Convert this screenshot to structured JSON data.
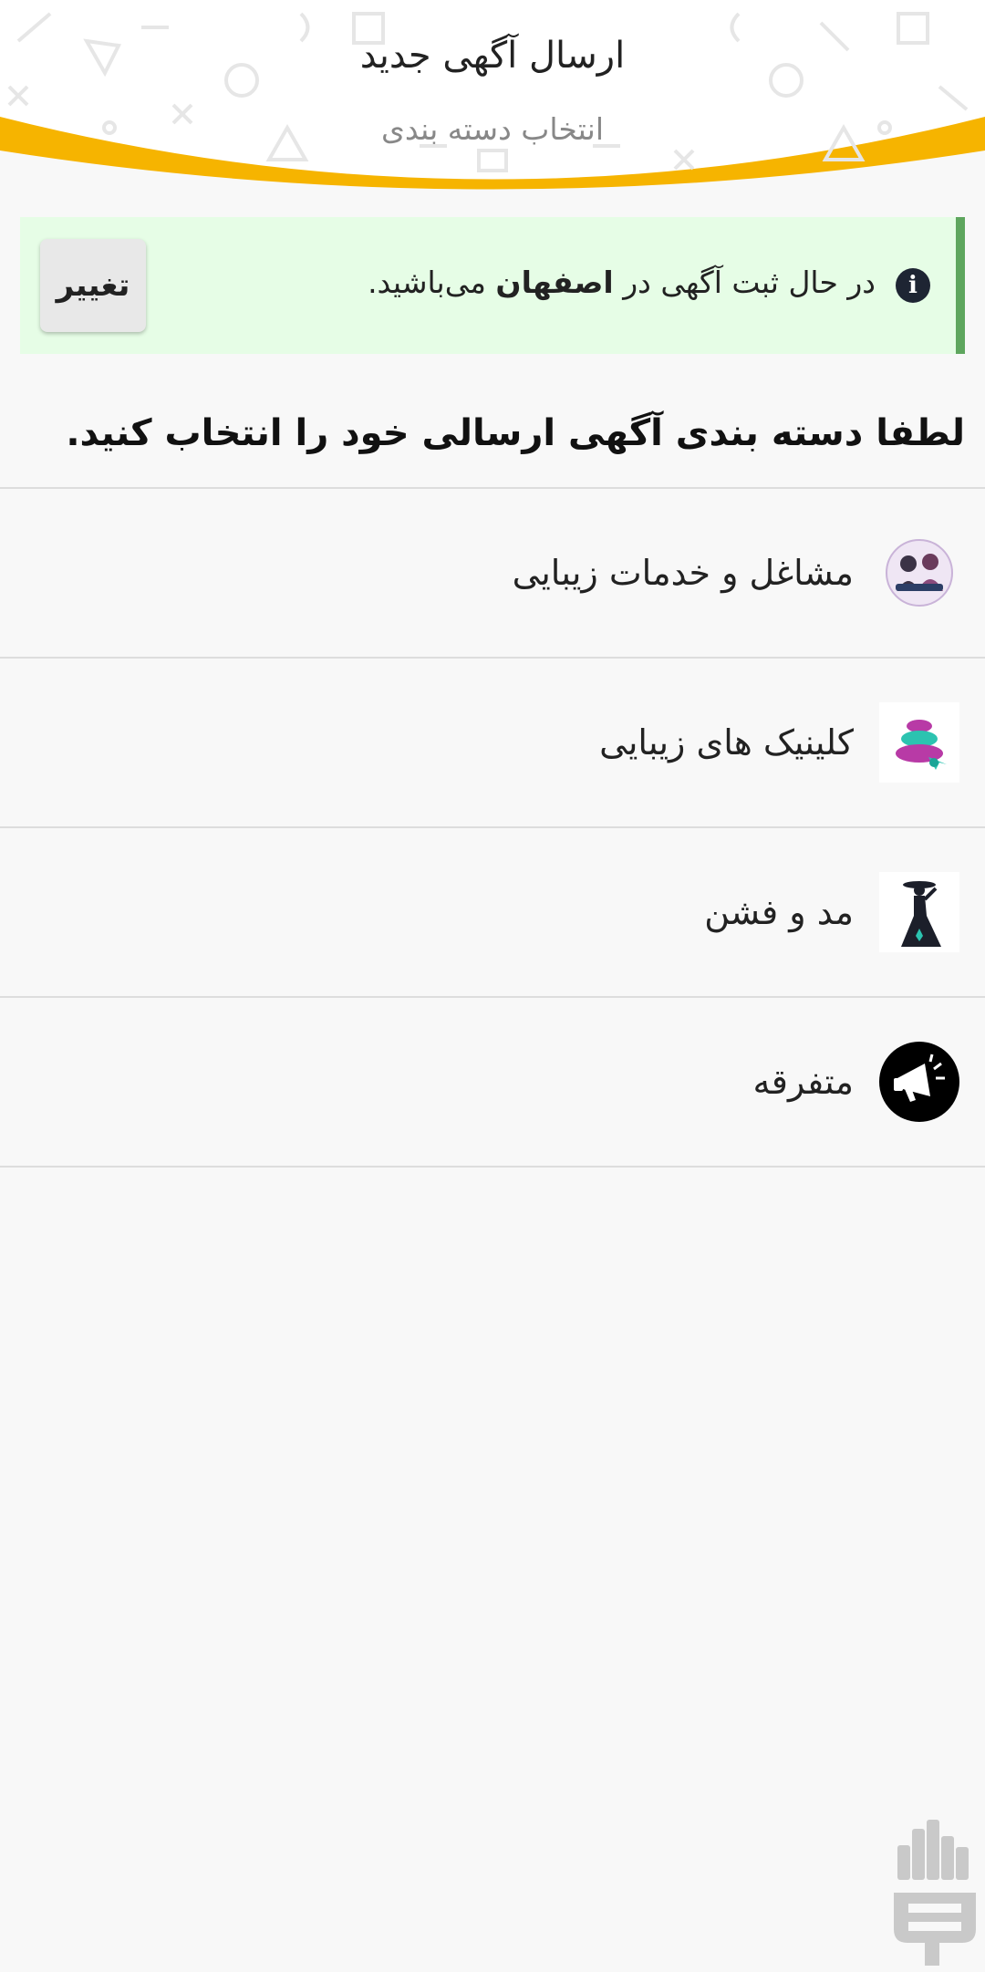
{
  "header": {
    "title": "ارسال آگهی جدید",
    "subtitle": "انتخاب دسته بندی",
    "accent_color": "#f6b400"
  },
  "banner": {
    "icon": "info-icon",
    "text_before": "در حال ثبت آگهی در",
    "city": "اصفهان",
    "text_after": "می‌باشید.",
    "change_label": "تغییر",
    "bg_color": "#e6fde6",
    "border_color": "#5ea65e"
  },
  "prompt": "لطفا دسته بندی آگهی ارسالی خود را انتخاب کنید.",
  "categories": [
    {
      "label": "مشاغل و خدمات زیبایی",
      "icon": "beauty-services-logo-icon"
    },
    {
      "label": "کلینیک های زیبایی",
      "icon": "spa-stones-icon"
    },
    {
      "label": "مد و فشن",
      "icon": "fashion-woman-icon"
    },
    {
      "label": "متفرقه",
      "icon": "megaphone-icon"
    }
  ],
  "brand": {
    "icon": "app-brand-icon",
    "color": "#c9c9c9"
  }
}
